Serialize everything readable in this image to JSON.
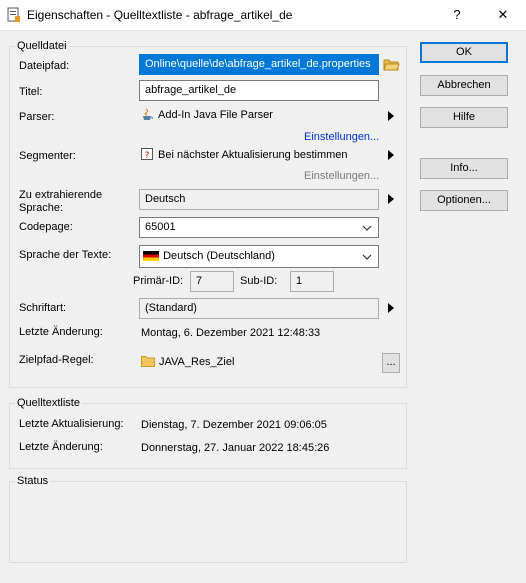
{
  "window": {
    "title": "Eigenschaften - Quelltextliste - abfrage_artikel_de",
    "help_btn": "?",
    "close_btn": "✕"
  },
  "groups": {
    "source": "Quelldatei",
    "list": "Quelltextliste",
    "status": "Status"
  },
  "fields": {
    "path_label": "Dateipfad:",
    "path_value": "Online\\quelle\\de\\abfrage_artikel_de.properties",
    "title_label": "Titel:",
    "title_value": "abfrage_artikel_de",
    "parser_label": "Parser:",
    "parser_value": "Add-In Java File Parser",
    "parser_settings": "Einstellungen...",
    "segmenter_label": "Segmenter:",
    "segmenter_value": "Bei nächster Aktualisierung bestimmen",
    "segmenter_settings": "Einstellungen...",
    "extract_label_1": "Zu extrahierende",
    "extract_label_2": "Sprache:",
    "extract_value": "Deutsch",
    "codepage_label": "Codepage:",
    "codepage_value": "65001",
    "textlang_label": "Sprache der Texte:",
    "textlang_value": "Deutsch (Deutschland)",
    "primary_label": "Primär-ID:",
    "primary_value": "7",
    "sub_label": "Sub-ID:",
    "sub_value": "1",
    "font_label": "Schriftart:",
    "font_value": "(Standard)",
    "lastchange_label": "Letzte Änderung:",
    "lastchange_value": "Montag, 6. Dezember 2021 12:48:33",
    "target_label": "Zielpfad-Regel:",
    "target_value": "JAVA_Res_Ziel",
    "target_btn": "..."
  },
  "list": {
    "update_label": "Letzte Aktualisierung:",
    "update_value": "Dienstag, 7. Dezember 2021 09:06:05",
    "change_label": "Letzte Änderung:",
    "change_value": "Donnerstag, 27. Januar 2022 18:45:26"
  },
  "buttons": {
    "ok": "OK",
    "cancel": "Abbrechen",
    "help": "Hilfe",
    "info": "Info...",
    "options": "Optionen..."
  },
  "colors": {
    "accent": "#0078d7",
    "link": "#0033cc"
  }
}
